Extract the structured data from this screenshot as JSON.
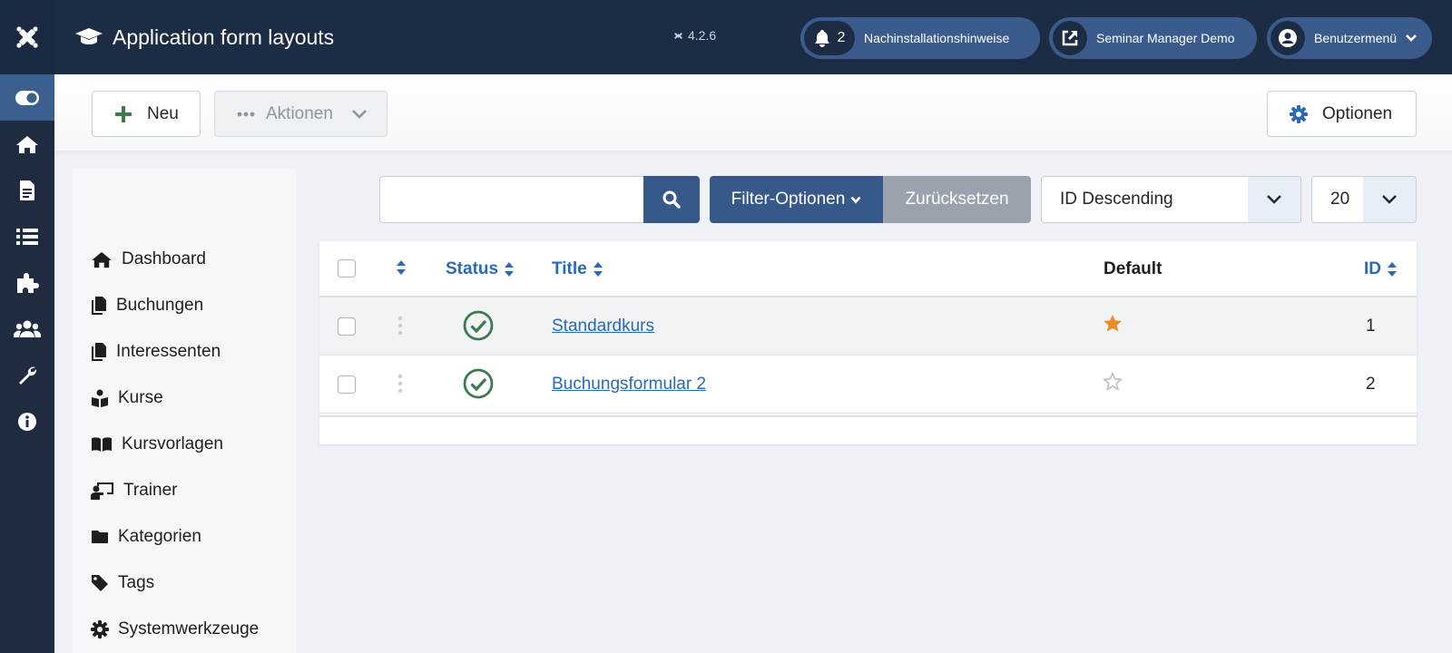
{
  "header": {
    "title": "Application form layouts",
    "version": "4.2.6",
    "notifications_count": "2",
    "post_install_label": "Nachinstallationshinweise",
    "site_label": "Seminar Manager Demo",
    "user_menu_label": "Benutzermenü"
  },
  "rail": {
    "items": [
      "toggle-menu-icon",
      "home-icon",
      "content-icon",
      "menus-icon",
      "extensions-icon",
      "users-icon",
      "system-icon",
      "help-icon"
    ]
  },
  "toolbar": {
    "new_label": "Neu",
    "actions_label": "Aktionen",
    "options_label": "Optionen"
  },
  "submenu": {
    "items": [
      {
        "label": "Dashboard",
        "icon": "home-icon"
      },
      {
        "label": "Buchungen",
        "icon": "copy-icon"
      },
      {
        "label": "Interessenten",
        "icon": "copy-icon"
      },
      {
        "label": "Kurse",
        "icon": "reader-icon"
      },
      {
        "label": "Kursvorlagen",
        "icon": "book-icon"
      },
      {
        "label": "Trainer",
        "icon": "teacher-icon"
      },
      {
        "label": "Kategorien",
        "icon": "folder-icon"
      },
      {
        "label": "Tags",
        "icon": "tag-icon"
      },
      {
        "label": "Systemwerkzeuge",
        "icon": "gear-icon"
      }
    ]
  },
  "filters": {
    "search_value": "",
    "filter_options_label": "Filter-Optionen",
    "reset_label": "Zurücksetzen",
    "ordering_value": "ID Descending",
    "limit_value": "20"
  },
  "table": {
    "columns": {
      "status": "Status",
      "title": "Title",
      "default": "Default",
      "id": "ID"
    },
    "rows": [
      {
        "title": "Standardkurs",
        "status": "published",
        "default": true,
        "id": "1"
      },
      {
        "title": "Buchungsformular 2",
        "status": "published",
        "default": false,
        "id": "2"
      }
    ]
  },
  "colors": {
    "header_bg": "#1c2c45",
    "accent": "#37598a",
    "link": "#2a69b8",
    "published": "#3d7a4f",
    "star_default": "#f08a24"
  }
}
